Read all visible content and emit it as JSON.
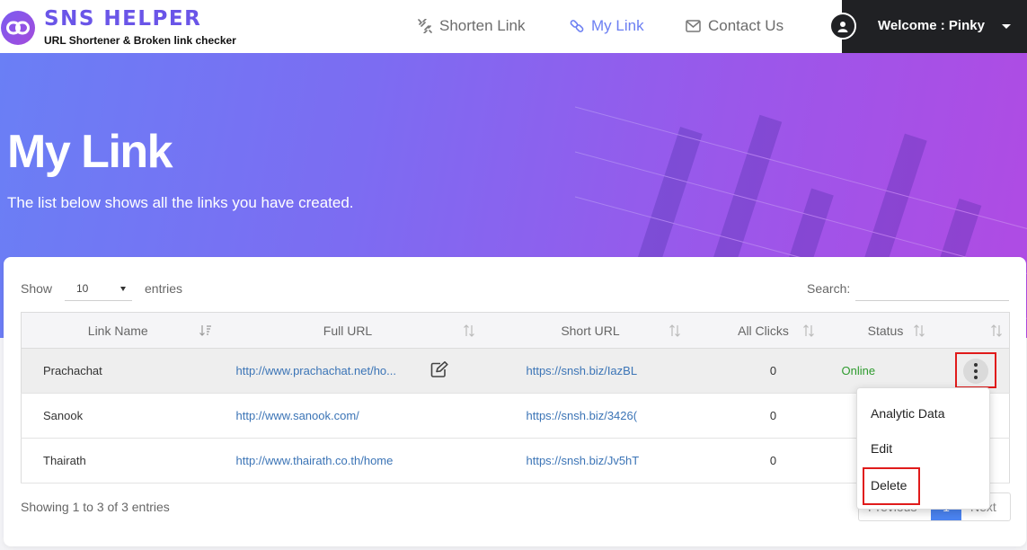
{
  "brand": {
    "title": "SNS HELPER",
    "subtitle": "URL Shortener & Broken link checker"
  },
  "nav": {
    "items": [
      {
        "label": "Shorten Link",
        "icon": "broken-link-icon",
        "active": false
      },
      {
        "label": "My Link",
        "icon": "link-icon",
        "active": true
      },
      {
        "label": "Contact Us",
        "icon": "envelope-icon",
        "active": false
      }
    ],
    "user": {
      "label": "Welcome : Pinky",
      "icon": "user-icon"
    }
  },
  "hero": {
    "title": "My Link",
    "subtitle": "The list below shows all the links you have created."
  },
  "table_controls": {
    "show_label": "Show",
    "entries_value": "10",
    "entries_label": "entries",
    "search_label": "Search:",
    "search_value": ""
  },
  "table": {
    "columns": [
      "Link Name",
      "Full URL",
      "Short URL",
      "All Clicks",
      "Status",
      ""
    ],
    "rows": [
      {
        "name": "Prachachat",
        "full_url": "http://www.prachachat.net/ho...",
        "short_url": "https://snsh.biz/IazBL",
        "clicks": "0",
        "status": "Online"
      },
      {
        "name": "Sanook",
        "full_url": "http://www.sanook.com/",
        "short_url": "https://snsh.biz/3426(",
        "clicks": "0",
        "status": ""
      },
      {
        "name": "Thairath",
        "full_url": "http://www.thairath.co.th/home",
        "short_url": "https://snsh.biz/Jv5hT",
        "clicks": "0",
        "status": ""
      }
    ]
  },
  "footer": {
    "info": "Showing 1 to 3 of 3 entries",
    "previous": "Previous",
    "page": "1",
    "next": "Next"
  },
  "row_menu": {
    "items": [
      "Analytic Data",
      "Edit",
      "Delete"
    ]
  },
  "colors": {
    "accent": "#6c7ff2",
    "highlight": "#e01b1b",
    "online": "#2e9b2e",
    "link": "#3b74b6"
  }
}
